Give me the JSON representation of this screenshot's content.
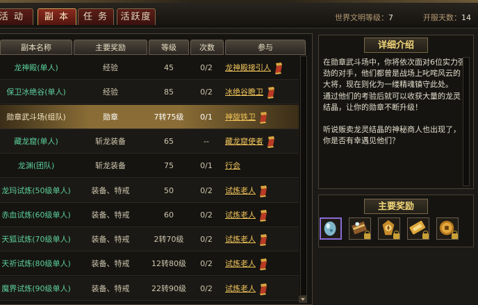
{
  "tabs": [
    {
      "label": "活 动",
      "active": false
    },
    {
      "label": "副 本",
      "active": true
    },
    {
      "label": "任 务",
      "active": false
    },
    {
      "label": "活跃度",
      "active": false
    }
  ],
  "header": {
    "world_level_label": "世界文明等级：",
    "world_level_value": "7",
    "server_days_label": "开服天数：",
    "server_days_value": "14"
  },
  "table": {
    "columns": [
      "副本名称",
      "主要奖励",
      "等级",
      "次数",
      "参与"
    ],
    "rows": [
      {
        "name": "龙神殿(单人)",
        "reward": "经验",
        "level": "45",
        "count": "0/2",
        "join": "龙神殿接引人",
        "icon": "scroll-icon"
      },
      {
        "name": "保卫冰绝谷(单人)",
        "reward": "经验",
        "level": "85",
        "count": "0/2",
        "join": "冰绝谷瞻卫",
        "icon": "scroll-icon"
      },
      {
        "name": "勋章武斗场(组队)",
        "reward": "勋章",
        "level": "7转75级",
        "count": "0/1",
        "join": "神旋铁卫",
        "icon": "scroll-icon",
        "selected": true
      },
      {
        "name": "藏龙窟(单人)",
        "reward": "斩龙装备",
        "level": "65",
        "count": "--",
        "join": "藏龙窟使者",
        "icon": "scroll-icon"
      },
      {
        "name": "龙渊(团队)",
        "reward": "斩龙装备",
        "level": "75",
        "count": "0/1",
        "join": "行会",
        "icon": ""
      },
      {
        "name": "龙玛试炼(50级单人)",
        "reward": "装备、特戒",
        "level": "50",
        "count": "0/2",
        "join": "试炼老人",
        "icon": "scroll-icon"
      },
      {
        "name": "赤血试炼(60级单人)",
        "reward": "装备、特戒",
        "level": "60",
        "count": "0/2",
        "join": "试炼老人",
        "icon": "scroll-icon"
      },
      {
        "name": "天狐试炼(70级单人)",
        "reward": "装备、特戒",
        "level": "2转70级",
        "count": "0/2",
        "join": "试炼老人",
        "icon": "scroll-icon"
      },
      {
        "name": "天祈试炼(80级单人)",
        "reward": "装备、特戒",
        "level": "12转80级",
        "count": "0/2",
        "join": "试炼老人",
        "icon": "scroll-icon"
      },
      {
        "name": "魔界试炼(90级单人)",
        "reward": "装备、特戒",
        "level": "22转90级",
        "count": "0/2",
        "join": "试炼老人",
        "icon": "scroll-icon"
      }
    ]
  },
  "detail": {
    "title": "详细介绍",
    "para1": "在勋章武斗场中，你将依次面对6位实力强劲的对手，他们都曾是战场上叱咤风云的大将，现在则化为一缕精魂镇守此处。",
    "para2": "通过他们的考验后就可以收获大量的龙灵结晶，让你的勋章不断升级！",
    "para3": "听说贩卖龙灵结晶的神秘商人也出现了，你是否有幸遇见他们？"
  },
  "rewards": {
    "title": "主要奖励",
    "items": [
      {
        "icon": "crystal-egg-icon",
        "selected": true,
        "locked": false
      },
      {
        "icon": "treasure-chest-icon",
        "selected": false,
        "locked": true
      },
      {
        "icon": "gold-medal-icon",
        "selected": false,
        "locked": true
      },
      {
        "icon": "gold-ticket-icon",
        "selected": false,
        "locked": true
      },
      {
        "icon": "gold-coin-icon",
        "selected": false,
        "locked": true
      }
    ]
  }
}
